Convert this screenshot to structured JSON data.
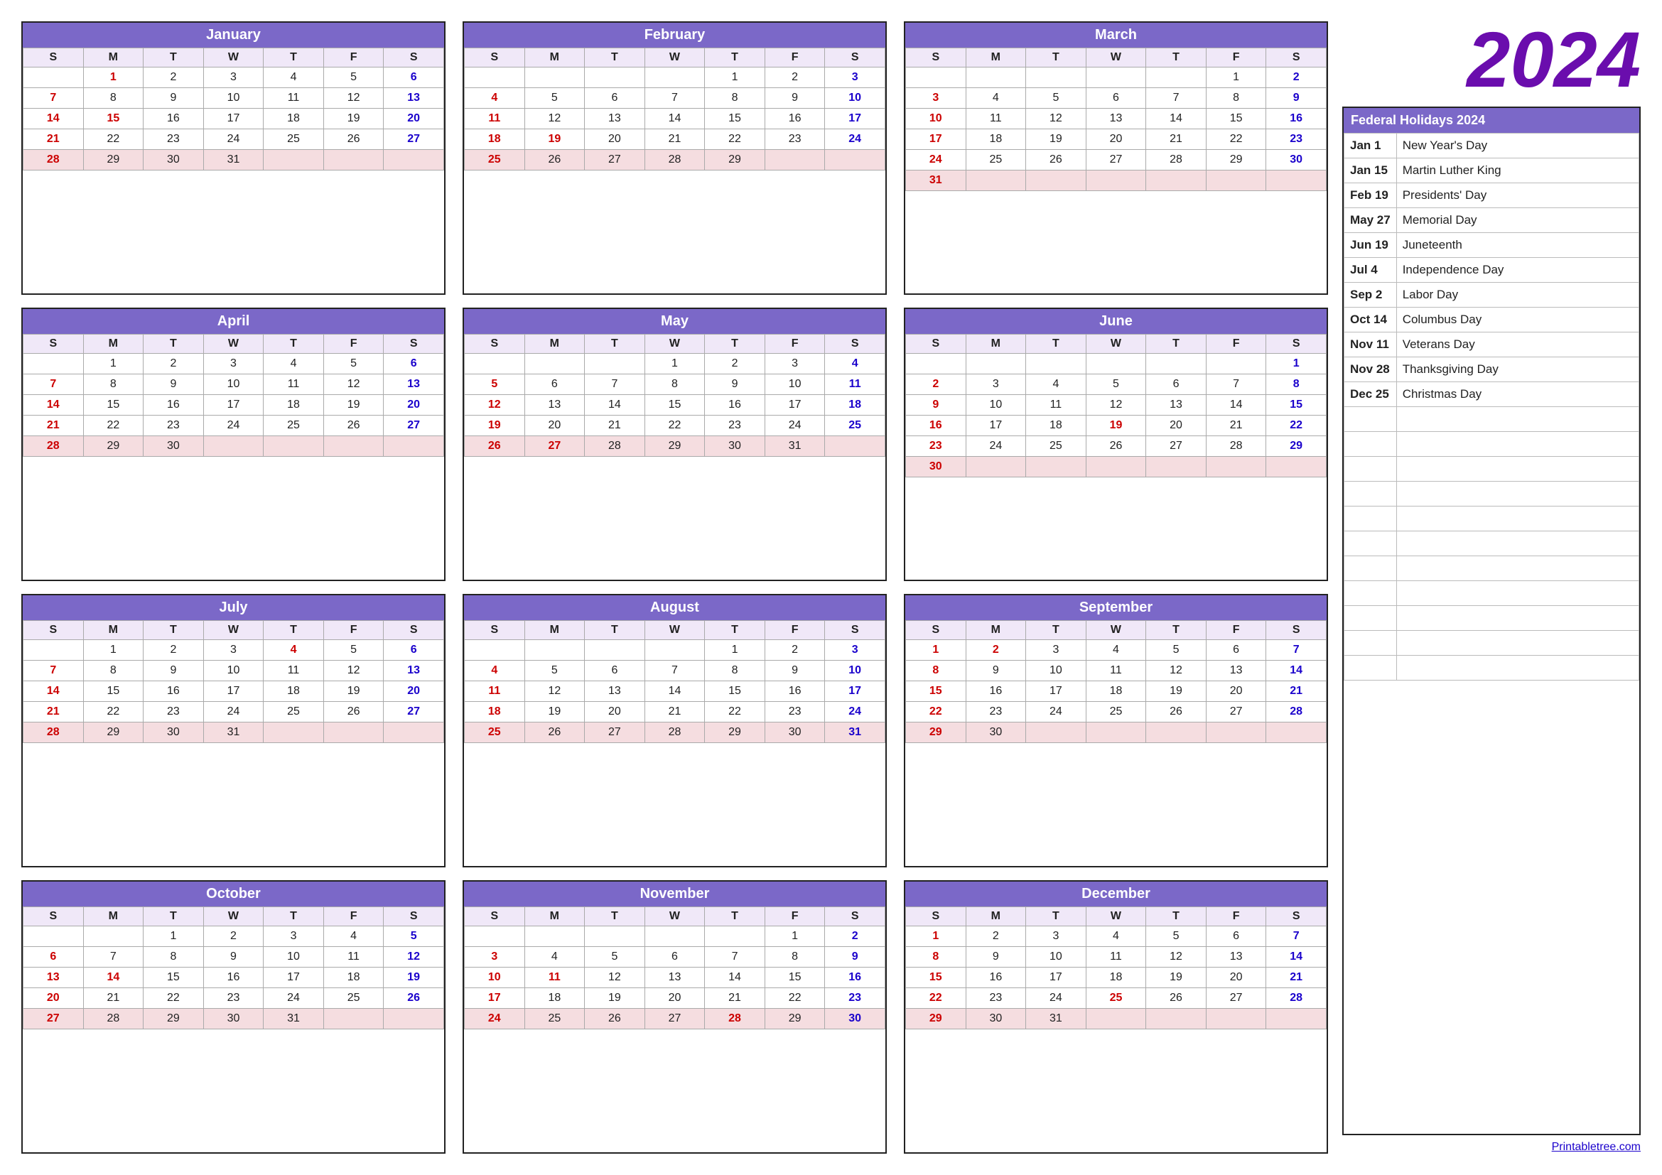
{
  "year": "2024",
  "footer": {
    "link": "Printabletree.com"
  },
  "holidays_header": "Federal Holidays 2024",
  "holidays": [
    {
      "date": "Jan 1",
      "name": "New Year's Day"
    },
    {
      "date": "Jan 15",
      "name": "Martin Luther King"
    },
    {
      "date": "Feb 19",
      "name": "Presidents' Day"
    },
    {
      "date": "May 27",
      "name": "Memorial Day"
    },
    {
      "date": "Jun 19",
      "name": "Juneteenth"
    },
    {
      "date": "Jul 4",
      "name": "Independence Day"
    },
    {
      "date": "Sep 2",
      "name": "Labor Day"
    },
    {
      "date": "Oct 14",
      "name": "Columbus Day"
    },
    {
      "date": "Nov 11",
      "name": "Veterans Day"
    },
    {
      "date": "Nov 28",
      "name": "Thanksgiving Day"
    },
    {
      "date": "Dec 25",
      "name": "Christmas Day"
    }
  ],
  "months": [
    {
      "name": "January",
      "days": [
        [
          0,
          1,
          2,
          3,
          4,
          5,
          6
        ],
        [
          7,
          8,
          9,
          10,
          11,
          12,
          13
        ],
        [
          14,
          15,
          16,
          17,
          18,
          19,
          20
        ],
        [
          21,
          22,
          23,
          24,
          25,
          26,
          27
        ],
        [
          28,
          29,
          30,
          31,
          0,
          0,
          0
        ]
      ],
      "startDay": 1
    },
    {
      "name": "February",
      "days": [
        [
          0,
          0,
          0,
          0,
          1,
          2,
          3
        ],
        [
          4,
          5,
          6,
          7,
          8,
          9,
          10
        ],
        [
          11,
          12,
          13,
          14,
          15,
          16,
          17
        ],
        [
          18,
          19,
          20,
          21,
          22,
          23,
          24
        ],
        [
          25,
          26,
          27,
          28,
          29,
          0,
          0
        ]
      ],
      "startDay": 4
    },
    {
      "name": "March",
      "days": [
        [
          0,
          0,
          0,
          0,
          0,
          1,
          2
        ],
        [
          3,
          4,
          5,
          6,
          7,
          8,
          9
        ],
        [
          10,
          11,
          12,
          13,
          14,
          15,
          16
        ],
        [
          17,
          18,
          19,
          20,
          21,
          22,
          23
        ],
        [
          24,
          25,
          26,
          27,
          28,
          29,
          30
        ],
        [
          31,
          0,
          0,
          0,
          0,
          0,
          0
        ]
      ],
      "startDay": 5
    },
    {
      "name": "April",
      "days": [
        [
          0,
          1,
          2,
          3,
          4,
          5,
          6
        ],
        [
          7,
          8,
          9,
          10,
          11,
          12,
          13
        ],
        [
          14,
          15,
          16,
          17,
          18,
          19,
          20
        ],
        [
          21,
          22,
          23,
          24,
          25,
          26,
          27
        ],
        [
          28,
          29,
          30,
          0,
          0,
          0,
          0
        ]
      ],
      "startDay": 1
    },
    {
      "name": "May",
      "days": [
        [
          0,
          0,
          0,
          1,
          2,
          3,
          4
        ],
        [
          5,
          6,
          7,
          8,
          9,
          10,
          11
        ],
        [
          12,
          13,
          14,
          15,
          16,
          17,
          18
        ],
        [
          19,
          20,
          21,
          22,
          23,
          24,
          25
        ],
        [
          26,
          27,
          28,
          29,
          30,
          31,
          0
        ]
      ],
      "startDay": 3
    },
    {
      "name": "June",
      "days": [
        [
          0,
          0,
          0,
          0,
          0,
          0,
          1
        ],
        [
          2,
          3,
          4,
          5,
          6,
          7,
          8
        ],
        [
          9,
          10,
          11,
          12,
          13,
          14,
          15
        ],
        [
          16,
          17,
          18,
          19,
          20,
          21,
          22
        ],
        [
          23,
          24,
          25,
          26,
          27,
          28,
          29
        ],
        [
          30,
          0,
          0,
          0,
          0,
          0,
          0
        ]
      ],
      "startDay": 6
    },
    {
      "name": "July",
      "days": [
        [
          0,
          1,
          2,
          3,
          4,
          5,
          6
        ],
        [
          7,
          8,
          9,
          10,
          11,
          12,
          13
        ],
        [
          14,
          15,
          16,
          17,
          18,
          19,
          20
        ],
        [
          21,
          22,
          23,
          24,
          25,
          26,
          27
        ],
        [
          28,
          29,
          30,
          31,
          0,
          0,
          0
        ]
      ],
      "startDay": 1
    },
    {
      "name": "August",
      "days": [
        [
          0,
          0,
          0,
          0,
          1,
          2,
          3
        ],
        [
          4,
          5,
          6,
          7,
          8,
          9,
          10
        ],
        [
          11,
          12,
          13,
          14,
          15,
          16,
          17
        ],
        [
          18,
          19,
          20,
          21,
          22,
          23,
          24
        ],
        [
          25,
          26,
          27,
          28,
          29,
          30,
          31
        ]
      ],
      "startDay": 4
    },
    {
      "name": "September",
      "days": [
        [
          1,
          2,
          3,
          4,
          5,
          6,
          7
        ],
        [
          8,
          9,
          10,
          11,
          12,
          13,
          14
        ],
        [
          15,
          16,
          17,
          18,
          19,
          20,
          21
        ],
        [
          22,
          23,
          24,
          25,
          26,
          27,
          28
        ],
        [
          29,
          30,
          0,
          0,
          0,
          0,
          0
        ]
      ],
      "startDay": 0
    },
    {
      "name": "October",
      "days": [
        [
          0,
          0,
          1,
          2,
          3,
          4,
          5
        ],
        [
          6,
          7,
          8,
          9,
          10,
          11,
          12
        ],
        [
          13,
          14,
          15,
          16,
          17,
          18,
          19
        ],
        [
          20,
          21,
          22,
          23,
          24,
          25,
          26
        ],
        [
          27,
          28,
          29,
          30,
          31,
          0,
          0
        ]
      ],
      "startDay": 2
    },
    {
      "name": "November",
      "days": [
        [
          0,
          0,
          0,
          0,
          0,
          1,
          2
        ],
        [
          3,
          4,
          5,
          6,
          7,
          8,
          9
        ],
        [
          10,
          11,
          12,
          13,
          14,
          15,
          16
        ],
        [
          17,
          18,
          19,
          20,
          21,
          22,
          23
        ],
        [
          24,
          25,
          26,
          27,
          28,
          29,
          30
        ]
      ],
      "startDay": 5
    },
    {
      "name": "December",
      "days": [
        [
          1,
          2,
          3,
          4,
          5,
          6,
          7
        ],
        [
          8,
          9,
          10,
          11,
          12,
          13,
          14
        ],
        [
          15,
          16,
          17,
          18,
          19,
          20,
          21
        ],
        [
          22,
          23,
          24,
          25,
          26,
          27,
          28
        ],
        [
          29,
          30,
          31,
          0,
          0,
          0,
          0
        ]
      ],
      "startDay": 0
    }
  ]
}
